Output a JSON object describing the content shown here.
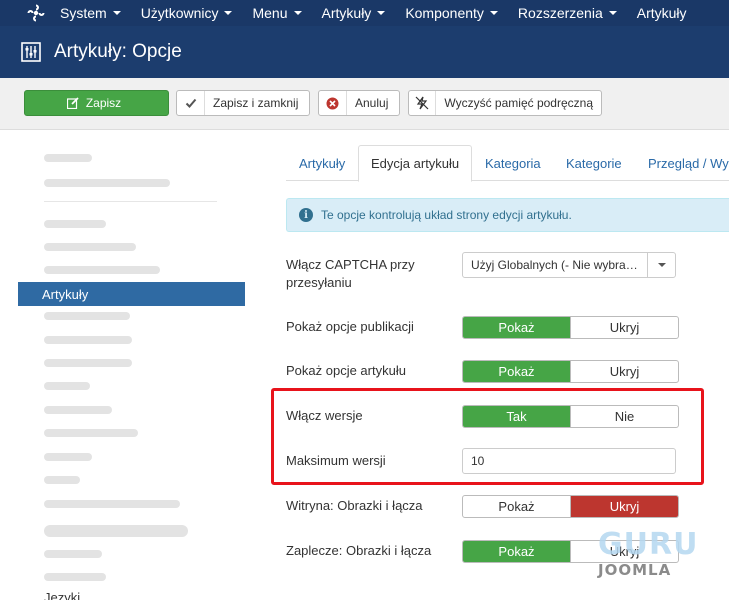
{
  "topnav": {
    "items": [
      {
        "label": "System"
      },
      {
        "label": "Użytkownicy"
      },
      {
        "label": "Menu"
      },
      {
        "label": "Artykuły"
      },
      {
        "label": "Komponenty"
      },
      {
        "label": "Rozszerzenia"
      },
      {
        "label": "Artykuły"
      }
    ]
  },
  "header": {
    "title": "Artykuły: Opcje",
    "icon": "sliders-icon"
  },
  "toolbar": {
    "save": "Zapisz",
    "save_close": "Zapisz i zamknij",
    "cancel": "Anuluj",
    "clear_cache": "Wyczyść pamięć podręczną"
  },
  "sidebar": {
    "active_item": "Artykuły",
    "last_item": "Języki"
  },
  "tabs": [
    {
      "label": "Artykuły"
    },
    {
      "label": "Edycja artykułu",
      "active": true
    },
    {
      "label": "Kategoria"
    },
    {
      "label": "Kategorie"
    },
    {
      "label": "Przegląd / Wyr"
    }
  ],
  "info": {
    "text": "Te opcje kontrolują układ strony edycji artykułu."
  },
  "form": {
    "captcha": {
      "label": "Włącz CAPTCHA przy przesyłaniu",
      "value": "Użyj Globalnych (- Nie wybra…"
    },
    "publishing": {
      "label": "Pokaż opcje publikacji",
      "options": [
        "Pokaż",
        "Ukryj"
      ],
      "selected": "Pokaż"
    },
    "article_opts": {
      "label": "Pokaż opcje artykułu",
      "options": [
        "Pokaż",
        "Ukryj"
      ],
      "selected": "Pokaż"
    },
    "versions": {
      "label": "Włącz wersje",
      "options": [
        "Tak",
        "Nie"
      ],
      "selected": "Tak"
    },
    "max_versions": {
      "label": "Maksimum wersji",
      "value": "10"
    },
    "frontend_images": {
      "label": "Witryna: Obrazki i łącza",
      "options": [
        "Pokaż",
        "Ukryj"
      ],
      "selected": "Ukryj"
    },
    "backend_images": {
      "label": "Zaplecze: Obrazki i łącza",
      "options": [
        "Pokaż",
        "Ukryj"
      ],
      "selected": "Pokaż"
    }
  },
  "watermark": {
    "line1": "GURU",
    "line2": "JOOMLA"
  },
  "colors": {
    "nav": "#1a3867",
    "header": "#1c3d6e",
    "green": "#46a546",
    "red": "#bd362f",
    "highlight": "#e8131b",
    "sidebar_active": "#2f6aa3"
  }
}
